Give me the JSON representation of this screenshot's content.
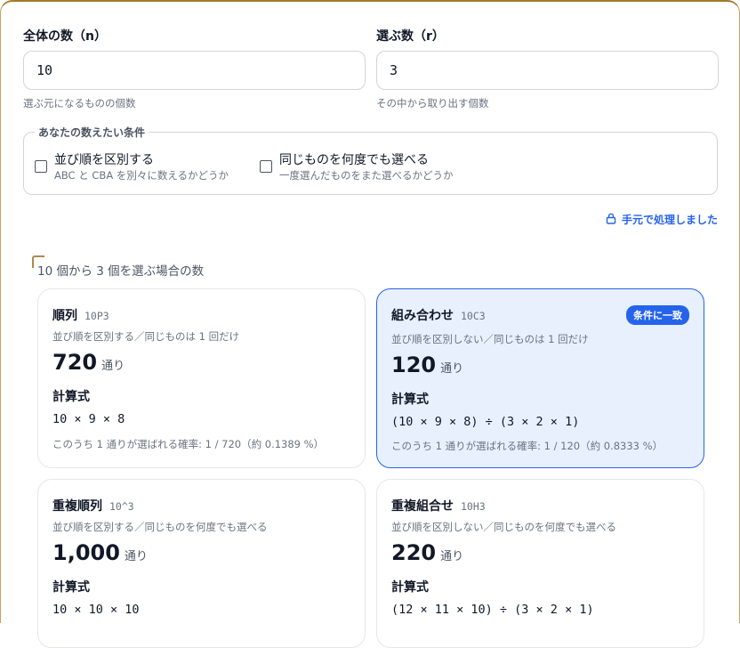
{
  "inputs": {
    "n": {
      "label": "全体の数（n）",
      "value": "10",
      "hint": "選ぶ元になるものの個数"
    },
    "r": {
      "label": "選ぶ数（r）",
      "value": "3",
      "hint": "その中から取り出す個数"
    }
  },
  "conditions": {
    "legend": "あなたの数えたい条件",
    "order": {
      "label": "並び順を区別する",
      "hint": "ABC と CBA を別々に数えるかどうか"
    },
    "repeat": {
      "label": "同じものを何度でも選べる",
      "hint": "一度選んだものをまた選べるかどうか"
    }
  },
  "local_note": "手元で処理しました",
  "results_title": "10 個から 3 個を選ぶ場合の数",
  "cards": [
    {
      "name": "順列",
      "code": "10P3",
      "desc": "並び順を区別する／同じものは 1 回だけ",
      "value": "720",
      "unit": "通り",
      "formula_label": "計算式",
      "formula": "10 × 9 × 8",
      "prob": "このうち 1 通りが選ばれる確率: 1 / 720（約 0.1389 %）",
      "highlight": false
    },
    {
      "name": "組み合わせ",
      "code": "10C3",
      "badge": "条件に一致",
      "desc": "並び順を区別しない／同じものは 1 回だけ",
      "value": "120",
      "unit": "通り",
      "formula_label": "計算式",
      "formula": "(10 × 9 × 8) ÷ (3 × 2 × 1)",
      "prob": "このうち 1 通りが選ばれる確率: 1 / 120（約 0.8333 %）",
      "highlight": true
    },
    {
      "name": "重複順列",
      "code": "10^3",
      "desc": "並び順を区別する／同じものを何度でも選べる",
      "value": "1,000",
      "unit": "通り",
      "formula_label": "計算式",
      "formula": "10 × 10 × 10",
      "highlight": false
    },
    {
      "name": "重複組合せ",
      "code": "10H3",
      "desc": "並び順を区別しない／同じものを何度でも選べる",
      "value": "220",
      "unit": "通り",
      "formula_label": "計算式",
      "formula": "(12 × 11 × 10) ÷ (3 × 2 × 1)",
      "highlight": false
    }
  ],
  "colors": {
    "accent": "#2563eb",
    "highlight_bg": "#e8f0fd",
    "frame": "#a07a2a"
  },
  "icons": {
    "local": "lock-icon"
  }
}
